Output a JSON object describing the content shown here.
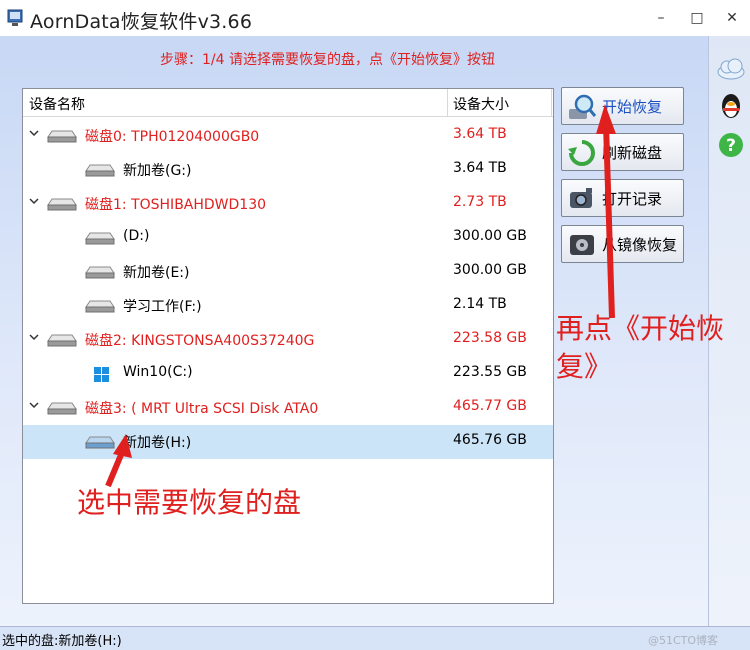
{
  "window": {
    "title": "AornData恢复软件v3.66",
    "controls": {
      "minimize": "–",
      "maximize": "□",
      "close": "✕"
    }
  },
  "step_text": "步骤：1/4 请选择需要恢复的盘，点《开始恢复》按钮",
  "disk_list": {
    "headers": {
      "name": "设备名称",
      "size": "设备大小"
    },
    "rows": [
      {
        "name": "磁盘0: TPH01204000GB0",
        "size": "3.64 TB",
        "kind": "disk",
        "icon": "hard-disk-icon"
      },
      {
        "name": "新加卷(G:)",
        "size": "3.64 TB",
        "kind": "volume",
        "icon": "volume-icon"
      },
      {
        "name": "磁盘1: TOSHIBAHDWD130",
        "size": "2.73 TB",
        "kind": "disk",
        "icon": "hard-disk-icon"
      },
      {
        "name": "(D:)",
        "size": "300.00 GB",
        "kind": "volume",
        "icon": "volume-icon"
      },
      {
        "name": "新加卷(E:)",
        "size": "300.00 GB",
        "kind": "volume",
        "icon": "volume-icon"
      },
      {
        "name": "学习工作(F:)",
        "size": "2.14 TB",
        "kind": "volume",
        "icon": "volume-icon"
      },
      {
        "name": "磁盘2: KINGSTONSA400S37240G",
        "size": "223.58 GB",
        "kind": "disk",
        "icon": "hard-disk-icon"
      },
      {
        "name": "Win10(C:)",
        "size": "223.55 GB",
        "kind": "volume",
        "icon": "windows-icon"
      },
      {
        "name": "磁盘3: ( MRT Ultra SCSI Disk ATA0",
        "size": "465.77 GB",
        "kind": "disk",
        "icon": "hard-disk-icon"
      },
      {
        "name": "新加卷(H:)",
        "size": "465.76 GB",
        "kind": "volume",
        "icon": "volume-icon",
        "selected": true
      }
    ]
  },
  "buttons": {
    "start": "开始恢复",
    "refresh": "刷新磁盘",
    "open_record": "打开记录",
    "image_restore": "从镜像恢复"
  },
  "sidebar": {
    "icons": [
      "cloud-icon",
      "qq-penguin-icon",
      "help-icon"
    ]
  },
  "status": {
    "text": "选中的盘:新加卷(H:)",
    "watermark": "@51CTO博客"
  },
  "annotations": {
    "select": "选中需要恢复的盘",
    "click_line1": "再点《开始恢",
    "click_line2": "复》"
  },
  "colors": {
    "accent_red": "#e0201f",
    "selection": "#cce4f7",
    "background": "#c5d6f4"
  }
}
